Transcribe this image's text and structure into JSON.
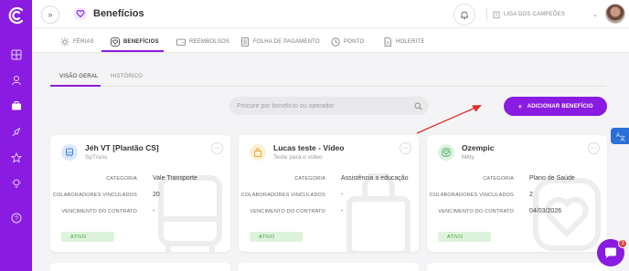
{
  "header": {
    "title": "Benefícios",
    "company": "LIGA DOS CAMPEÕES"
  },
  "tabs": [
    {
      "label": "FÉRIAS",
      "icon": "sun-icon"
    },
    {
      "label": "BENEFÍCIOS",
      "icon": "heart-icon"
    },
    {
      "label": "REEMBOLSOS",
      "icon": "wallet-icon"
    },
    {
      "label": "FOLHA DE PAGAMENTO",
      "icon": "calculator-icon"
    },
    {
      "label": "PONTO",
      "icon": "clock-icon"
    },
    {
      "label": "HOLERITE",
      "icon": "document-icon"
    }
  ],
  "subtabs": [
    {
      "label": "VISÃO GERAL"
    },
    {
      "label": "HISTÓRICO"
    }
  ],
  "search": {
    "placeholder": "Procure por benefício ou operador"
  },
  "add_button": {
    "label": "ADICIONAR BENEFÍCIO"
  },
  "field_labels": {
    "category": "CATEGORIA",
    "collaborators": "COLABORADORES VINCULADOS",
    "contract": "VENCIMENTO DO CONTRATO"
  },
  "cards": [
    {
      "title": "Jéh VT [Plantão CS]",
      "subtitle": "SpTrans",
      "category": "Vale Transporte",
      "collaborators": "20",
      "contract": "-",
      "status": "ATIVO",
      "icon": "bus-icon",
      "icon_bg": "#dbe9fb",
      "icon_color": "#3a7bd5"
    },
    {
      "title": "Lucas teste - Vídeo",
      "subtitle": "Teste para o vídeo",
      "category": "Assistência a educação",
      "collaborators": "-",
      "contract": "-",
      "status": "ATIVO",
      "icon": "bag-icon",
      "icon_bg": "#fdf0d3",
      "icon_color": "#e0a43a"
    },
    {
      "title": "Ozempic",
      "subtitle": "Mitty",
      "category": "Plano de Saúde",
      "collaborators": "2",
      "contract": "04/03/2026",
      "status": "ATIVO",
      "icon": "heart-icon",
      "icon_bg": "#dcf3e0",
      "icon_color": "#3fa85b"
    }
  ],
  "chat": {
    "badge": "3"
  },
  "colors": {
    "accent": "#8a1be0",
    "active_green": "#3f9e3b",
    "annotation": "#d9342b"
  }
}
